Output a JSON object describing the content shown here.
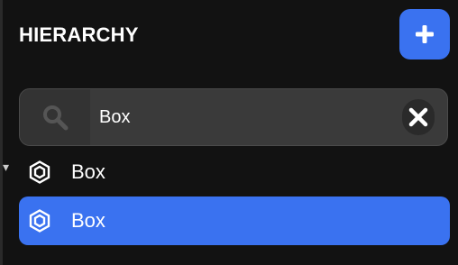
{
  "header": {
    "title": "HIERARCHY",
    "add_icon": "plus-icon"
  },
  "search": {
    "value": "Box",
    "search_icon": "search-icon",
    "clear_icon": "close-icon"
  },
  "tree": {
    "items": [
      {
        "label": "Box",
        "icon": "object-icon",
        "selected": false
      },
      {
        "label": "Box",
        "icon": "object-icon",
        "selected": true
      }
    ]
  },
  "colors": {
    "background": "#121212",
    "accent": "#3a72f0",
    "search_bg": "#3a3a3a"
  }
}
